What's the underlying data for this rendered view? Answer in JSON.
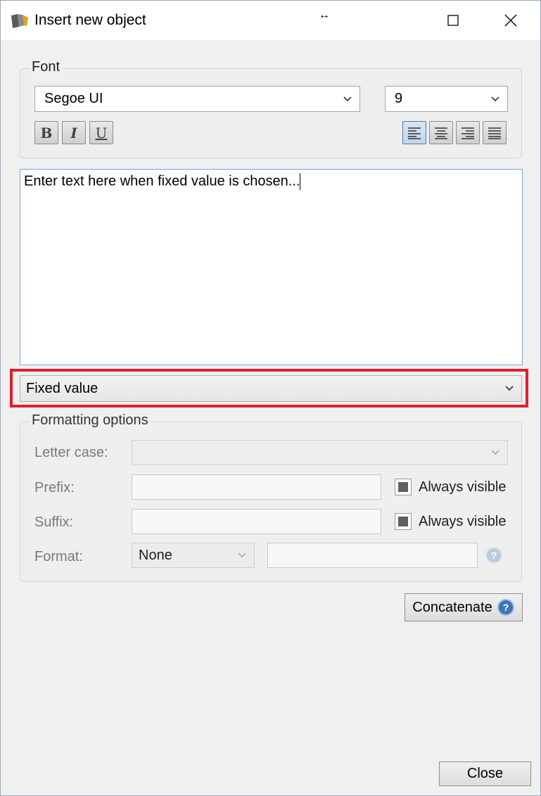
{
  "window": {
    "title": "Insert new object",
    "resize_glyph": "↔",
    "icons": {
      "app": "app-logo-icon",
      "maximize": "maximize-icon",
      "close": "close-icon"
    }
  },
  "font_group": {
    "legend": "Font",
    "font_family": "Segoe UI",
    "font_size": "9",
    "style_buttons": {
      "bold": "B",
      "italic": "I",
      "underline": "U"
    },
    "align_buttons": [
      "align-left-icon",
      "align-center-icon",
      "align-right-icon",
      "align-justify-icon"
    ],
    "active_align": "align-left"
  },
  "text_area": {
    "value": "Enter text here when fixed value is chosen..."
  },
  "source_select": {
    "value": "Fixed value",
    "highlight_color": "#e0202b"
  },
  "formatting_group": {
    "legend": "Formatting options",
    "letter_case_label": "Letter case:",
    "letter_case_value": "",
    "prefix_label": "Prefix:",
    "prefix_value": "",
    "prefix_always_visible": "Always visible",
    "suffix_label": "Suffix:",
    "suffix_value": "",
    "suffix_always_visible": "Always visible",
    "format_label": "Format:",
    "format_value": "None",
    "format_text": ""
  },
  "buttons": {
    "concatenate": "Concatenate",
    "close": "Close"
  },
  "colors": {
    "accent": "#3d75b8",
    "window_bg": "#f0f0f0"
  }
}
